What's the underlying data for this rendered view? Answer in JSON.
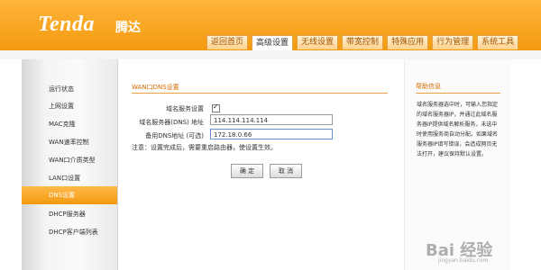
{
  "header": {
    "logo": "Tenda",
    "logo_cn": "腾达"
  },
  "tabs": [
    {
      "label": "返回首页",
      "active": false
    },
    {
      "label": "高级设置",
      "active": true
    },
    {
      "label": "无线设置",
      "active": false
    },
    {
      "label": "带宽控制",
      "active": false
    },
    {
      "label": "特殊应用",
      "active": false
    },
    {
      "label": "行为管理",
      "active": false
    },
    {
      "label": "系统工具",
      "active": false
    }
  ],
  "sidebar": {
    "items": [
      {
        "label": "运行状态"
      },
      {
        "label": "上网设置"
      },
      {
        "label": "MAC克隆"
      },
      {
        "label": "WAN速率控制"
      },
      {
        "label": "WAN口介质类型"
      },
      {
        "label": "LAN口设置"
      },
      {
        "label": "DNS设置",
        "active": true
      },
      {
        "label": "DHCP服务器"
      },
      {
        "label": "DHCP客户端列表"
      }
    ]
  },
  "form": {
    "title": "WAN口DNS设置",
    "dns_service_label": "域名服务设置",
    "dns_service_checked": true,
    "primary_dns_label": "域名服务器(DNS) 地址",
    "primary_dns_value": "114.114.114.114",
    "secondary_dns_label": "备用DNS地址 (可选)",
    "secondary_dns_value": "172.18.0.66",
    "note": "注意：设置完成后，需要重启路由器，使设置生效。",
    "ok_label": "确 定",
    "cancel_label": "取 消"
  },
  "help": {
    "title": "帮助信息",
    "text": "域名服务器选中时，可输入您指定的域名服务器IP，并通过此域名服务器IP提供域名解析服务，未选中时使用服务商自动分配。如果域名服务器IP填写错误，会造成网页无法打开，建议保持默认设置。"
  },
  "watermark": {
    "brand": "Bai 经验",
    "url": "jingyan.baidu.com"
  }
}
